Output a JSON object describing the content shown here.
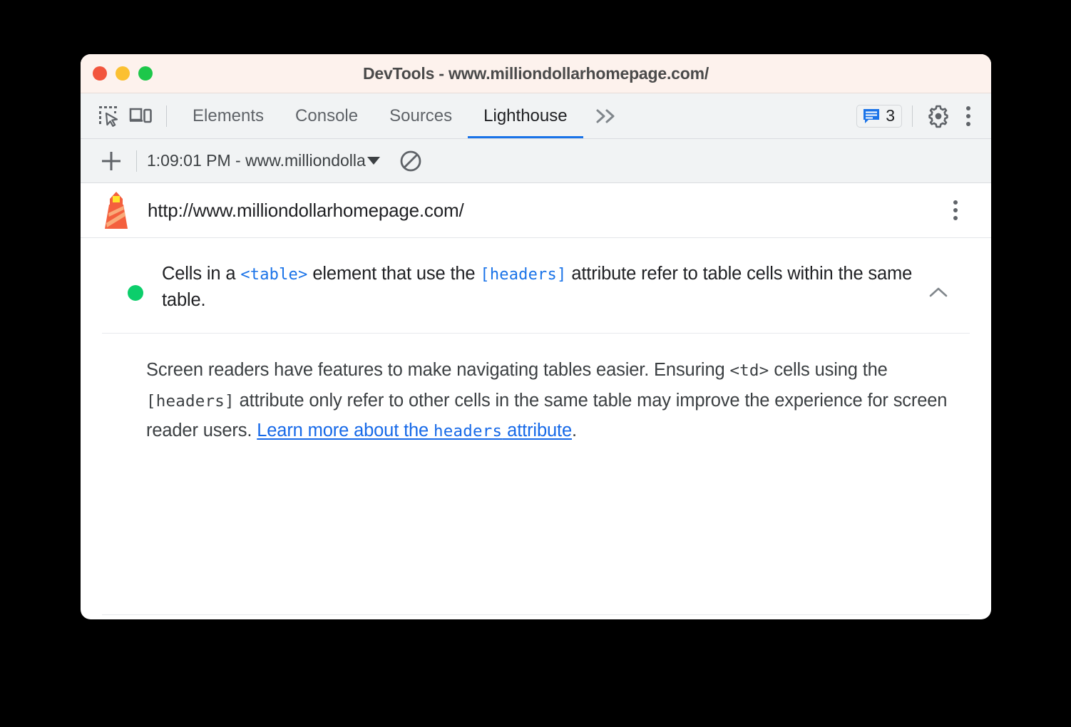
{
  "window": {
    "title": "DevTools - www.milliondollarhomepage.com/",
    "traffic_lights": [
      {
        "name": "close",
        "color": "#f2553d"
      },
      {
        "name": "minimize",
        "color": "#fbc031"
      },
      {
        "name": "maximize",
        "color": "#1dc74a"
      }
    ]
  },
  "tabstrip": {
    "icons": [
      {
        "name": "inspect-element-icon",
        "label": "Inspect element"
      },
      {
        "name": "device-toolbar-icon",
        "label": "Toggle device toolbar"
      }
    ],
    "tabs": [
      {
        "label": "Elements",
        "active": false
      },
      {
        "label": "Console",
        "active": false
      },
      {
        "label": "Sources",
        "active": false
      },
      {
        "label": "Lighthouse",
        "active": true
      }
    ],
    "more_tabs_label": "»",
    "messages_count": "3",
    "settings_label": "Settings",
    "more_options_label": "Customize and control DevTools",
    "active_tab_underline_color": "#1a73e8"
  },
  "runbar": {
    "new_report_label": "+",
    "selected_run": "1:09:01 PM - www.milliondolla",
    "clear_label": "Clear all"
  },
  "report": {
    "url": "http://www.milliondollarhomepage.com/",
    "options_label": "Report options"
  },
  "audit": {
    "status": "pass",
    "status_color": "#0cce6b",
    "title_parts": [
      {
        "type": "text",
        "value": "Cells in a "
      },
      {
        "type": "code_blue",
        "value": "<table>"
      },
      {
        "type": "text",
        "value": " element that use the "
      },
      {
        "type": "code_blue",
        "value": "[headers]"
      },
      {
        "type": "text",
        "value": " attribute refer to table cells within the same table."
      }
    ],
    "title_plain": "Cells in a <table> element that use the [headers] attribute refer to table cells within the same table.",
    "collapse_icon": "chevron-up-icon",
    "description_parts": [
      {
        "type": "text",
        "value": "Screen readers have features to make navigating tables easier. Ensuring "
      },
      {
        "type": "code",
        "value": "<td>"
      },
      {
        "type": "text",
        "value": " cells using the "
      },
      {
        "type": "code",
        "value": "[headers]"
      },
      {
        "type": "text",
        "value": " attribute only refer to other cells in the same table may improve the experience for screen reader users. "
      },
      {
        "type": "link",
        "value": "Learn more about the headers attribute",
        "link_text_before_code": "Learn more about the ",
        "link_code": "headers",
        "link_text_after_code": " attribute"
      },
      {
        "type": "text",
        "value": "."
      }
    ],
    "description_plain": "Screen readers have features to make navigating tables easier. Ensuring <td> cells using the [headers] attribute only refer to other cells in the same table may improve the experience for screen reader users. Learn more about the headers attribute."
  },
  "fragments": {
    "desc_s1": "Screen readers have features to make navigating tables easier. Ensuring ",
    "desc_td": "<td>",
    "desc_s2": " cells using the ",
    "desc_headers": "[headers]",
    "desc_s3": " attribute only refer to other cells in the same table may improve the experience for screen reader users. ",
    "link_pre": "Learn more about the ",
    "link_code": "headers",
    "link_post": " attribute",
    "desc_period": ".",
    "title_s1": "Cells in a ",
    "title_table": "<table>",
    "title_s2": " element that use the ",
    "title_headers": "[headers]",
    "title_s3": " attribute refer to table cells within the same table."
  }
}
